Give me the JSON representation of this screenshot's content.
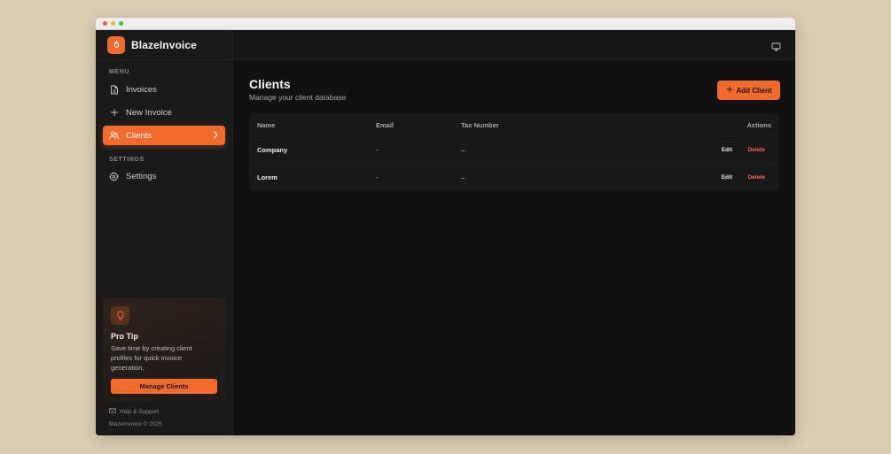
{
  "brand": {
    "name": "BlazeInvoice",
    "accent": "#f26b2c"
  },
  "sidebar": {
    "menu_label": "MENU",
    "items": [
      {
        "label": "Invoices",
        "icon": "document-icon",
        "active": false
      },
      {
        "label": "New Invoice",
        "icon": "plus-icon",
        "active": false
      },
      {
        "label": "Clients",
        "icon": "users-icon",
        "active": true
      }
    ],
    "settings_label": "SETTINGS",
    "settings_item": {
      "label": "Settings",
      "icon": "gear-icon"
    },
    "protip": {
      "title": "Pro Tip",
      "text": "Save time by creating client profiles for quick invoice generation.",
      "button": "Manage Clients",
      "icon": "lightbulb-icon"
    },
    "help": "Help & Support",
    "copyright": "BlazeInvoice © 2025"
  },
  "topbar": {
    "icon": "monitor-icon"
  },
  "page": {
    "title": "Clients",
    "subtitle": "Manage your client database",
    "add_button": "Add Client"
  },
  "table": {
    "headers": {
      "name": "Name",
      "email": "Email",
      "tax": "Tax Number",
      "actions": "Actions"
    },
    "rows": [
      {
        "name": "Company",
        "email": "-",
        "tax": "–",
        "edit": "Edit",
        "delete": "Delete"
      },
      {
        "name": "Lorem",
        "email": "-",
        "tax": "–",
        "edit": "Edit",
        "delete": "Delete"
      }
    ]
  }
}
